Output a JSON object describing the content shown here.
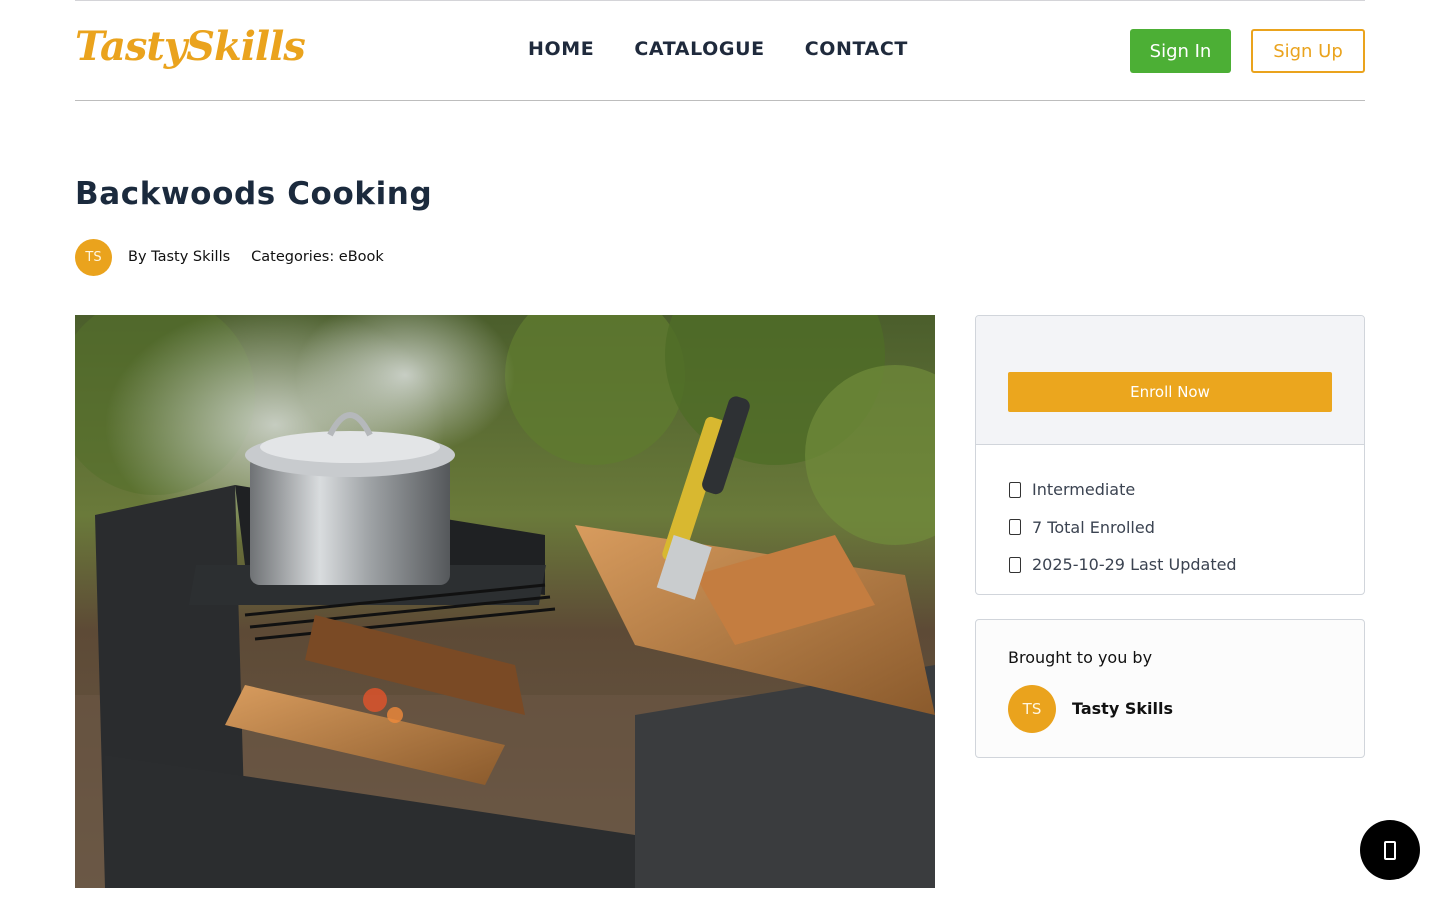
{
  "brand": {
    "logo_text": "TastySkills",
    "accent": "#eaa31d",
    "green": "#4caf35"
  },
  "nav": {
    "items": [
      "HOME",
      "CATALOGUE",
      "CONTACT"
    ]
  },
  "auth": {
    "signin_label": "Sign In",
    "signup_label": "Sign Up"
  },
  "course": {
    "title": "Backwoods Cooking",
    "author_initials": "TS",
    "by_line": "By Tasty Skills",
    "categories": "Categories: eBook"
  },
  "hero": {
    "image_icon": "campfire-photo"
  },
  "enroll_card": {
    "enroll_label": "Enroll Now",
    "info": [
      {
        "icon": "level-icon",
        "text": "Intermediate"
      },
      {
        "icon": "users-icon",
        "text": "7 Total Enrolled"
      },
      {
        "icon": "calendar-icon",
        "text": "2025-10-29 Last Updated"
      }
    ]
  },
  "author_card": {
    "heading": "Brought to you by",
    "initials": "TS",
    "name": "Tasty Skills"
  },
  "chat": {
    "icon": "chat-icon"
  }
}
